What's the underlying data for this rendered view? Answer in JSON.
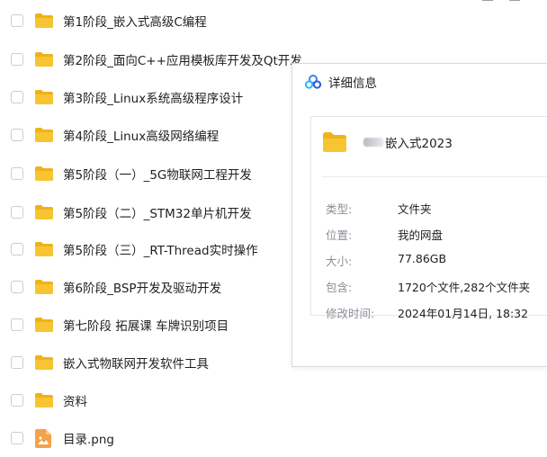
{
  "list": {
    "items": [
      {
        "name": "第1阶段_嵌入式高级C编程",
        "type": "folder"
      },
      {
        "name": "第2阶段_面向C++应用模板库开发及Qt开发",
        "type": "folder"
      },
      {
        "name": "第3阶段_Linux系统高级程序设计",
        "type": "folder"
      },
      {
        "name": "第4阶段_Linux高级网络编程",
        "type": "folder"
      },
      {
        "name": "第5阶段（一）_5G物联网工程开发",
        "type": "folder"
      },
      {
        "name": "第5阶段（二）_STM32单片机开发",
        "type": "folder"
      },
      {
        "name": "第5阶段（三）_RT-Thread实时操作",
        "type": "folder"
      },
      {
        "name": "第6阶段_BSP开发及驱动开发",
        "type": "folder"
      },
      {
        "name": "第七阶段 拓展课 车牌识别项目",
        "type": "folder"
      },
      {
        "name": "嵌入式物联网开发软件工具",
        "type": "folder"
      },
      {
        "name": "资料",
        "type": "folder"
      },
      {
        "name": "目录.png",
        "type": "image"
      }
    ]
  },
  "detail": {
    "title": "详细信息",
    "folder_name": "嵌入式2023",
    "rows": [
      {
        "label": "类型:",
        "value": "文件夹"
      },
      {
        "label": "位置:",
        "value": "我的网盘"
      },
      {
        "label": "大小:",
        "value": "77.86GB"
      },
      {
        "label": "包含:",
        "value": "1720个文件,282个文件夹"
      },
      {
        "label": "修改时间:",
        "value": "2024年01月14日, 18:32"
      }
    ]
  },
  "colors": {
    "folder": "#f7c531",
    "folder_dark": "#efb21a",
    "png_icon": "#f5a04a"
  }
}
